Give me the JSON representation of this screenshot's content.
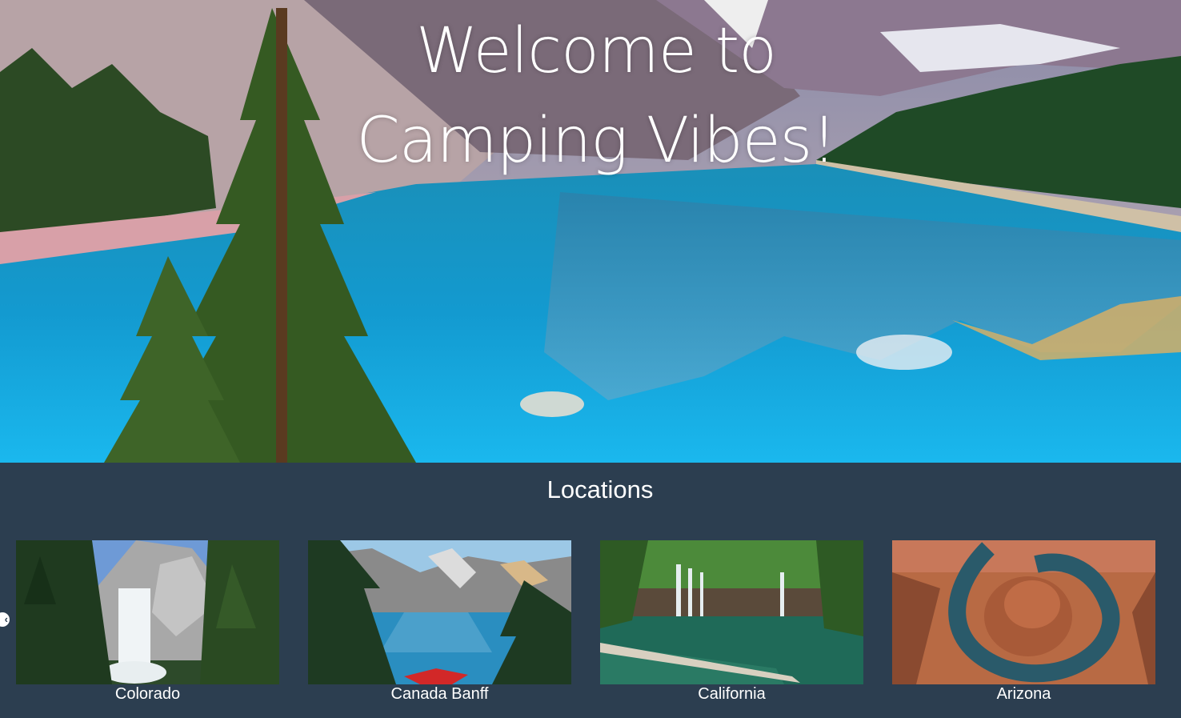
{
  "hero": {
    "title_line1": "Welcome to",
    "title_line2": "Camping Vibes!"
  },
  "locations": {
    "heading": "Locations",
    "prev_icon": "chevron-left-icon",
    "items": [
      {
        "label": "Colorado",
        "image": "waterfall-forest"
      },
      {
        "label": "Canada Banff",
        "image": "mountain-lake-hammock"
      },
      {
        "label": "California",
        "image": "waterfall-pool"
      },
      {
        "label": "Arizona",
        "image": "canyon-river-bend"
      }
    ]
  },
  "colors": {
    "section_background": "#2c3e50",
    "text": "#ffffff",
    "lake": "#17a8e0"
  }
}
